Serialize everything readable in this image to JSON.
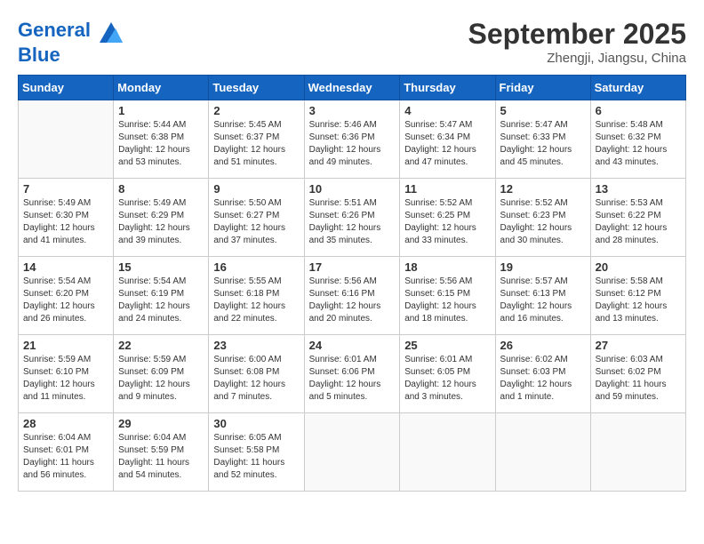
{
  "header": {
    "logo_line1": "General",
    "logo_line2": "Blue",
    "month": "September 2025",
    "location": "Zhengji, Jiangsu, China"
  },
  "weekdays": [
    "Sunday",
    "Monday",
    "Tuesday",
    "Wednesday",
    "Thursday",
    "Friday",
    "Saturday"
  ],
  "weeks": [
    [
      {
        "day": "",
        "info": ""
      },
      {
        "day": "1",
        "info": "Sunrise: 5:44 AM\nSunset: 6:38 PM\nDaylight: 12 hours\nand 53 minutes."
      },
      {
        "day": "2",
        "info": "Sunrise: 5:45 AM\nSunset: 6:37 PM\nDaylight: 12 hours\nand 51 minutes."
      },
      {
        "day": "3",
        "info": "Sunrise: 5:46 AM\nSunset: 6:36 PM\nDaylight: 12 hours\nand 49 minutes."
      },
      {
        "day": "4",
        "info": "Sunrise: 5:47 AM\nSunset: 6:34 PM\nDaylight: 12 hours\nand 47 minutes."
      },
      {
        "day": "5",
        "info": "Sunrise: 5:47 AM\nSunset: 6:33 PM\nDaylight: 12 hours\nand 45 minutes."
      },
      {
        "day": "6",
        "info": "Sunrise: 5:48 AM\nSunset: 6:32 PM\nDaylight: 12 hours\nand 43 minutes."
      }
    ],
    [
      {
        "day": "7",
        "info": "Sunrise: 5:49 AM\nSunset: 6:30 PM\nDaylight: 12 hours\nand 41 minutes."
      },
      {
        "day": "8",
        "info": "Sunrise: 5:49 AM\nSunset: 6:29 PM\nDaylight: 12 hours\nand 39 minutes."
      },
      {
        "day": "9",
        "info": "Sunrise: 5:50 AM\nSunset: 6:27 PM\nDaylight: 12 hours\nand 37 minutes."
      },
      {
        "day": "10",
        "info": "Sunrise: 5:51 AM\nSunset: 6:26 PM\nDaylight: 12 hours\nand 35 minutes."
      },
      {
        "day": "11",
        "info": "Sunrise: 5:52 AM\nSunset: 6:25 PM\nDaylight: 12 hours\nand 33 minutes."
      },
      {
        "day": "12",
        "info": "Sunrise: 5:52 AM\nSunset: 6:23 PM\nDaylight: 12 hours\nand 30 minutes."
      },
      {
        "day": "13",
        "info": "Sunrise: 5:53 AM\nSunset: 6:22 PM\nDaylight: 12 hours\nand 28 minutes."
      }
    ],
    [
      {
        "day": "14",
        "info": "Sunrise: 5:54 AM\nSunset: 6:20 PM\nDaylight: 12 hours\nand 26 minutes."
      },
      {
        "day": "15",
        "info": "Sunrise: 5:54 AM\nSunset: 6:19 PM\nDaylight: 12 hours\nand 24 minutes."
      },
      {
        "day": "16",
        "info": "Sunrise: 5:55 AM\nSunset: 6:18 PM\nDaylight: 12 hours\nand 22 minutes."
      },
      {
        "day": "17",
        "info": "Sunrise: 5:56 AM\nSunset: 6:16 PM\nDaylight: 12 hours\nand 20 minutes."
      },
      {
        "day": "18",
        "info": "Sunrise: 5:56 AM\nSunset: 6:15 PM\nDaylight: 12 hours\nand 18 minutes."
      },
      {
        "day": "19",
        "info": "Sunrise: 5:57 AM\nSunset: 6:13 PM\nDaylight: 12 hours\nand 16 minutes."
      },
      {
        "day": "20",
        "info": "Sunrise: 5:58 AM\nSunset: 6:12 PM\nDaylight: 12 hours\nand 13 minutes."
      }
    ],
    [
      {
        "day": "21",
        "info": "Sunrise: 5:59 AM\nSunset: 6:10 PM\nDaylight: 12 hours\nand 11 minutes."
      },
      {
        "day": "22",
        "info": "Sunrise: 5:59 AM\nSunset: 6:09 PM\nDaylight: 12 hours\nand 9 minutes."
      },
      {
        "day": "23",
        "info": "Sunrise: 6:00 AM\nSunset: 6:08 PM\nDaylight: 12 hours\nand 7 minutes."
      },
      {
        "day": "24",
        "info": "Sunrise: 6:01 AM\nSunset: 6:06 PM\nDaylight: 12 hours\nand 5 minutes."
      },
      {
        "day": "25",
        "info": "Sunrise: 6:01 AM\nSunset: 6:05 PM\nDaylight: 12 hours\nand 3 minutes."
      },
      {
        "day": "26",
        "info": "Sunrise: 6:02 AM\nSunset: 6:03 PM\nDaylight: 12 hours\nand 1 minute."
      },
      {
        "day": "27",
        "info": "Sunrise: 6:03 AM\nSunset: 6:02 PM\nDaylight: 11 hours\nand 59 minutes."
      }
    ],
    [
      {
        "day": "28",
        "info": "Sunrise: 6:04 AM\nSunset: 6:01 PM\nDaylight: 11 hours\nand 56 minutes."
      },
      {
        "day": "29",
        "info": "Sunrise: 6:04 AM\nSunset: 5:59 PM\nDaylight: 11 hours\nand 54 minutes."
      },
      {
        "day": "30",
        "info": "Sunrise: 6:05 AM\nSunset: 5:58 PM\nDaylight: 11 hours\nand 52 minutes."
      },
      {
        "day": "",
        "info": ""
      },
      {
        "day": "",
        "info": ""
      },
      {
        "day": "",
        "info": ""
      },
      {
        "day": "",
        "info": ""
      }
    ]
  ]
}
